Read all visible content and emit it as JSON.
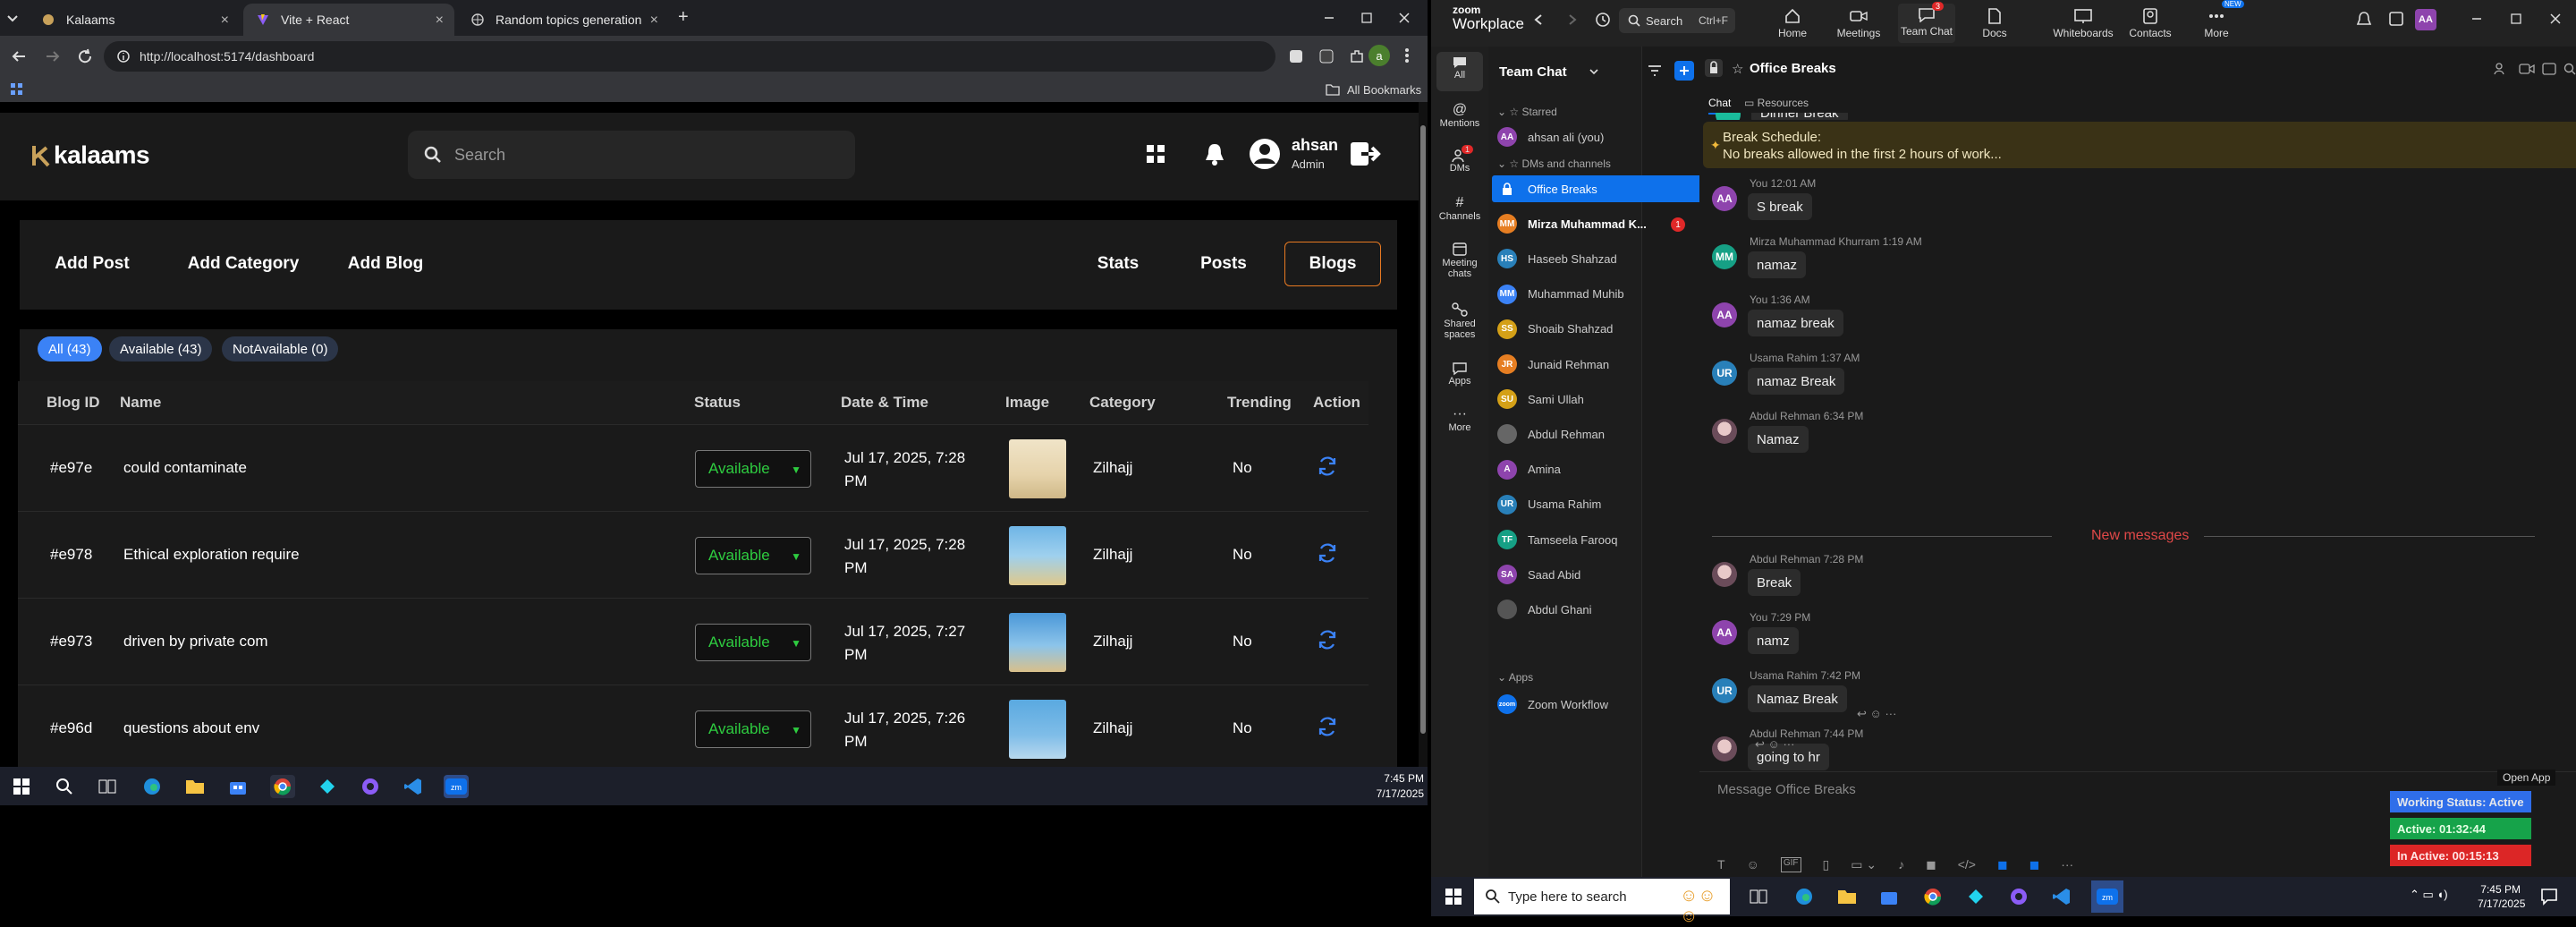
{
  "browser": {
    "tabs": [
      {
        "title": "Kalaams"
      },
      {
        "title": "Vite + React"
      },
      {
        "title": "Random topics generation"
      }
    ],
    "new_tab": "+",
    "url": "http://localhost:5174/dashboard",
    "all_bookmarks": "All Bookmarks",
    "profile_initial": "a"
  },
  "dashboard": {
    "logo": "kalaams",
    "search_placeholder": "Search",
    "user": {
      "name": "ahsan",
      "role": "Admin"
    },
    "actions": {
      "add_post": "Add Post",
      "add_category": "Add Category",
      "add_blog": "Add Blog"
    },
    "views": {
      "stats": "Stats",
      "posts": "Posts",
      "blogs": "Blogs"
    },
    "filters": {
      "all": "All (43)",
      "available": "Available (43)",
      "not_available": "NotAvailable (0)"
    },
    "columns": {
      "id": "Blog ID",
      "name": "Name",
      "status": "Status",
      "date": "Date & Time",
      "image": "Image",
      "category": "Category",
      "trending": "Trending",
      "action": "Action"
    },
    "rows": [
      {
        "id": "#e97e",
        "name": "could contaminate",
        "status": "Available",
        "date1": "Jul 17, 2025, 7:28",
        "date2": "PM",
        "category": "Zilhajj",
        "trending": "No"
      },
      {
        "id": "#e978",
        "name": "Ethical exploration require",
        "status": "Available",
        "date1": "Jul 17, 2025, 7:28",
        "date2": "PM",
        "category": "Zilhajj",
        "trending": "No"
      },
      {
        "id": "#e973",
        "name": "driven by private com",
        "status": "Available",
        "date1": "Jul 17, 2025, 7:27",
        "date2": "PM",
        "category": "Zilhajj",
        "trending": "No"
      },
      {
        "id": "#e96d",
        "name": "questions about env",
        "status": "Available",
        "date1": "Jul 17, 2025, 7:26",
        "date2": "PM",
        "category": "Zilhajj",
        "trending": "No"
      }
    ]
  },
  "taskbar_left": {
    "time": "7:45 PM",
    "date": "7/17/2025"
  },
  "zoom": {
    "brand_top": "zoom",
    "brand_bottom": "Workplace",
    "search": "Search",
    "search_shortcut": "Ctrl+F",
    "nav": [
      {
        "label": "Home"
      },
      {
        "label": "Meetings"
      },
      {
        "label": "Team Chat",
        "badge": "3"
      },
      {
        "label": "Docs"
      },
      {
        "label": "Whiteboards"
      },
      {
        "label": "Contacts"
      },
      {
        "label": "More",
        "badge": "NEW"
      }
    ],
    "avatar_initials": "AA",
    "rail": [
      {
        "label": "All"
      },
      {
        "label": "Mentions"
      },
      {
        "label": "DMs",
        "badge": "1"
      },
      {
        "label": "Channels"
      },
      {
        "label": "Meeting chats"
      },
      {
        "label": "Shared spaces"
      },
      {
        "label": "Apps"
      },
      {
        "label": "More"
      }
    ],
    "list_title": "Team Chat",
    "sections": {
      "starred": "Starred",
      "dms": "DMs and channels",
      "apps": "Apps"
    },
    "starred": [
      {
        "initials": "AA",
        "name": "ahsan ali (you)"
      }
    ],
    "contacts": [
      {
        "initials": "",
        "name": "Office Breaks"
      },
      {
        "initials": "MM",
        "name": "Mirza Muhammad K...",
        "badge": "1"
      },
      {
        "initials": "HS",
        "name": "Haseeb Shahzad"
      },
      {
        "initials": "MM",
        "name": "Muhammad Muhib"
      },
      {
        "initials": "SS",
        "name": "Shoaib Shahzad"
      },
      {
        "initials": "JR",
        "name": "Junaid Rehman"
      },
      {
        "initials": "SU",
        "name": "Sami Ullah"
      },
      {
        "initials": "",
        "name": "Abdul Rehman"
      },
      {
        "initials": "A",
        "name": "Amina"
      },
      {
        "initials": "UR",
        "name": "Usama Rahim"
      },
      {
        "initials": "TF",
        "name": "Tamseela Farooq"
      },
      {
        "initials": "SA",
        "name": "Saad Abid"
      },
      {
        "initials": "",
        "name": "Abdul Ghani"
      }
    ],
    "apps": [
      {
        "initials": "zoom",
        "name": "Zoom Workflow"
      }
    ],
    "channel": {
      "title": "Office Breaks",
      "tab_chat": "Chat",
      "tab_resources": "Resources"
    },
    "clipped_text": "Dinner Break",
    "banner": {
      "title": "Break Schedule:",
      "text": "No breaks allowed in the first 2 hours of work..."
    },
    "messages_before": [
      {
        "initials": "AA",
        "meta": "You 12:01 AM",
        "text": "S break"
      },
      {
        "initials": "MM",
        "meta": "Mirza Muhammad Khurram 1:19 AM",
        "text": "namaz"
      },
      {
        "initials": "AA",
        "meta": "You 1:36 AM",
        "text": "namaz break"
      },
      {
        "initials": "UR",
        "meta": "Usama Rahim 1:37 AM",
        "text": "namaz Break"
      },
      {
        "initials": "",
        "meta": "Abdul Rehman 6:34 PM",
        "text": "Namaz"
      }
    ],
    "new_messages": "New messages",
    "messages_after": [
      {
        "initials": "",
        "meta": "Abdul Rehman 7:28 PM",
        "text": "Break"
      },
      {
        "initials": "AA",
        "meta": "You 7:29 PM",
        "text": "namz"
      },
      {
        "initials": "UR",
        "meta": "Usama Rahim 7:42 PM",
        "text": "Namaz Break"
      },
      {
        "initials": "",
        "meta": "Abdul Rehman 7:44 PM",
        "text": "going to hr"
      }
    ],
    "composer_placeholder": "Message Office Breaks",
    "open_app": "Open App",
    "status_lines": {
      "working": "Working Status: Active",
      "active": "Active: 01:32:44",
      "inactive": "In Active: 00:15:13"
    },
    "colors": {
      "accent": "#0e71eb",
      "working": "#2563eb",
      "active": "#16a34a",
      "inactive": "#dc2626"
    }
  },
  "taskbar_right": {
    "search": "Type here to search",
    "time": "7:45 PM",
    "date": "7/17/2025"
  }
}
